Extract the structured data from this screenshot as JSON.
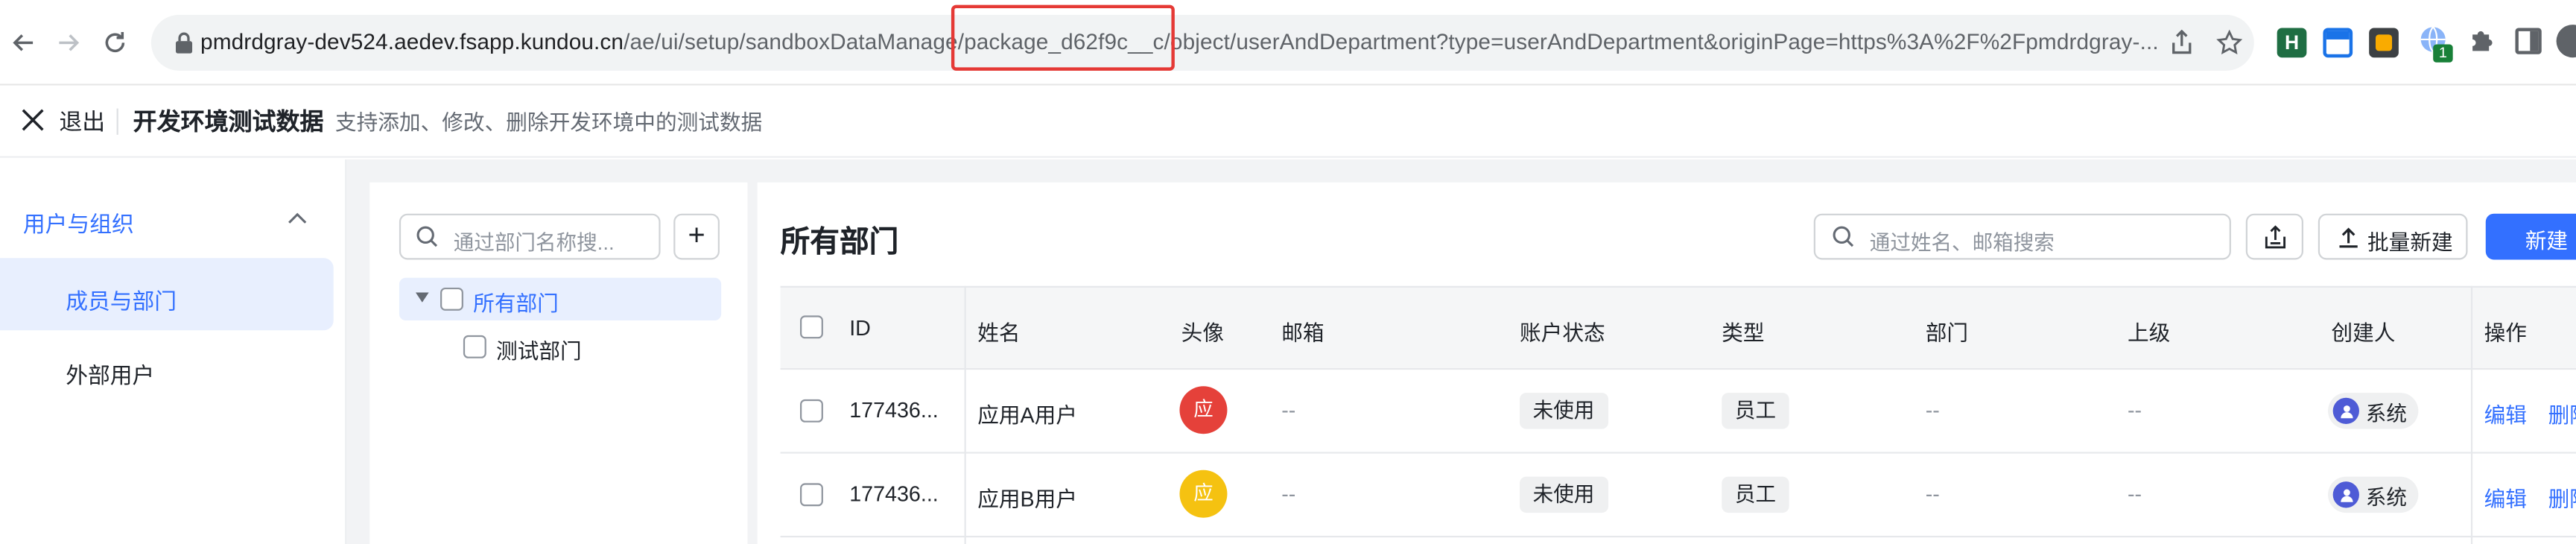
{
  "browser": {
    "url_host": "pmdrdgray-dev524.aedev.fsapp.kundou.cn",
    "url_path_before": "/ae/ui/setup/sandboxDataManage",
    "url_highlight": "/package_d62f9c__c/",
    "url_path_after": "object/userAndDepartment?type=userAndDepartment&originPage=https%3A%2F%2Fpmdrdgray-...",
    "extension_badge": "1",
    "ext_letter": "H"
  },
  "header": {
    "exit_label": "退出",
    "title": "开发环境测试数据",
    "description": "支持添加、修改、删除开发环境中的测试数据"
  },
  "sidebar": {
    "group_label": "用户与组织",
    "items": [
      {
        "label": "成员与部门",
        "active": true
      },
      {
        "label": "外部用户",
        "active": false
      }
    ]
  },
  "dept_tree": {
    "search_placeholder": "通过部门名称搜...",
    "nodes": [
      {
        "label": "所有部门",
        "selected": true
      },
      {
        "label": "测试部门",
        "selected": false
      }
    ]
  },
  "main": {
    "title": "所有部门",
    "search_placeholder": "通过姓名、邮箱搜索",
    "bulk_create_label": "批量新建",
    "new_label": "新建"
  },
  "table": {
    "columns": [
      "ID",
      "姓名",
      "头像",
      "邮箱",
      "账户状态",
      "类型",
      "部门",
      "上级",
      "创建人",
      "操作"
    ],
    "rows": [
      {
        "id": "177436...",
        "name": "应用A用户",
        "avatar_char": "应",
        "avatar_color": "#e5413a",
        "email": "--",
        "status": "未使用",
        "type": "员工",
        "dept": "--",
        "manager": "--",
        "creator": "系统",
        "edit": "编辑",
        "delete": "删除"
      },
      {
        "id": "177436...",
        "name": "应用B用户",
        "avatar_char": "应",
        "avatar_color": "#f5c211",
        "email": "--",
        "status": "未使用",
        "type": "员工",
        "dept": "--",
        "manager": "--",
        "creator": "系统",
        "edit": "编辑",
        "delete": "删除"
      }
    ]
  },
  "colors": {
    "accent": "#3370ff",
    "highlight_box": "#e53935"
  }
}
